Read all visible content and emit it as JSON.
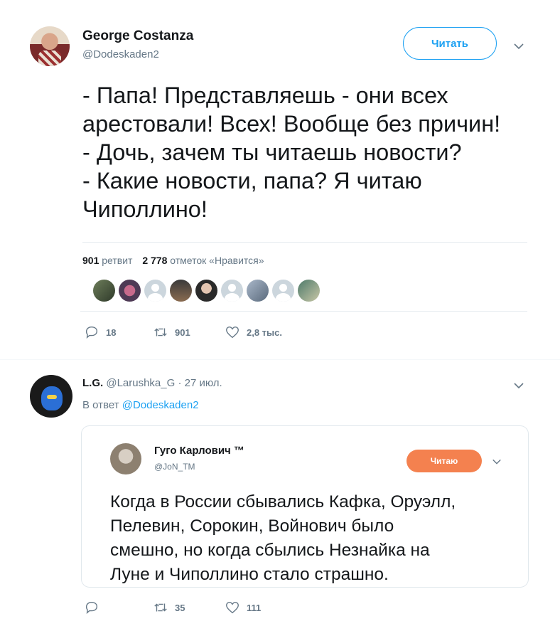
{
  "tweet": {
    "author_name": "George Costanza",
    "author_handle": "@Dodeskaden2",
    "follow_label": "Читать",
    "text_lines": [
      "- Папа! Представляешь - они всех",
      "арестовали! Всех! Вообще без причин!",
      "- Дочь, зачем ты читаешь новости?",
      "- Какие новости, папа? Я читаю",
      "Чиполлино!"
    ],
    "retweets_count": "901",
    "retweets_label": "ретвит",
    "likes_count": "2 778",
    "likes_label": "отметок «Нравится»",
    "actions": {
      "reply": "18",
      "retweet": "901",
      "like": "2,8 тыс."
    }
  },
  "reply": {
    "author_name": "L.G.",
    "author_handle": "@Larushka_G",
    "date": "· 27 июл.",
    "in_reply_prefix": "В ответ",
    "in_reply_handle": "@Dodeskaden2",
    "quote": {
      "author_name": "Гуго Карлович ™",
      "author_handle": "@JoN_TM",
      "follow_label": "Читаю",
      "text_lines": [
        "Когда в России сбывались Кафка, Оруэлл,",
        "Пелевин, Сорокин, Войнович было",
        "смешно, но когда сбылись Незнайка на",
        "Луне и Чиполлино стало страшно."
      ]
    },
    "actions": {
      "reply": "",
      "retweet": "35",
      "like": "111"
    }
  },
  "colors": {
    "accent": "#1da1f2",
    "orange_button": "#f4814f",
    "muted": "#657786"
  }
}
